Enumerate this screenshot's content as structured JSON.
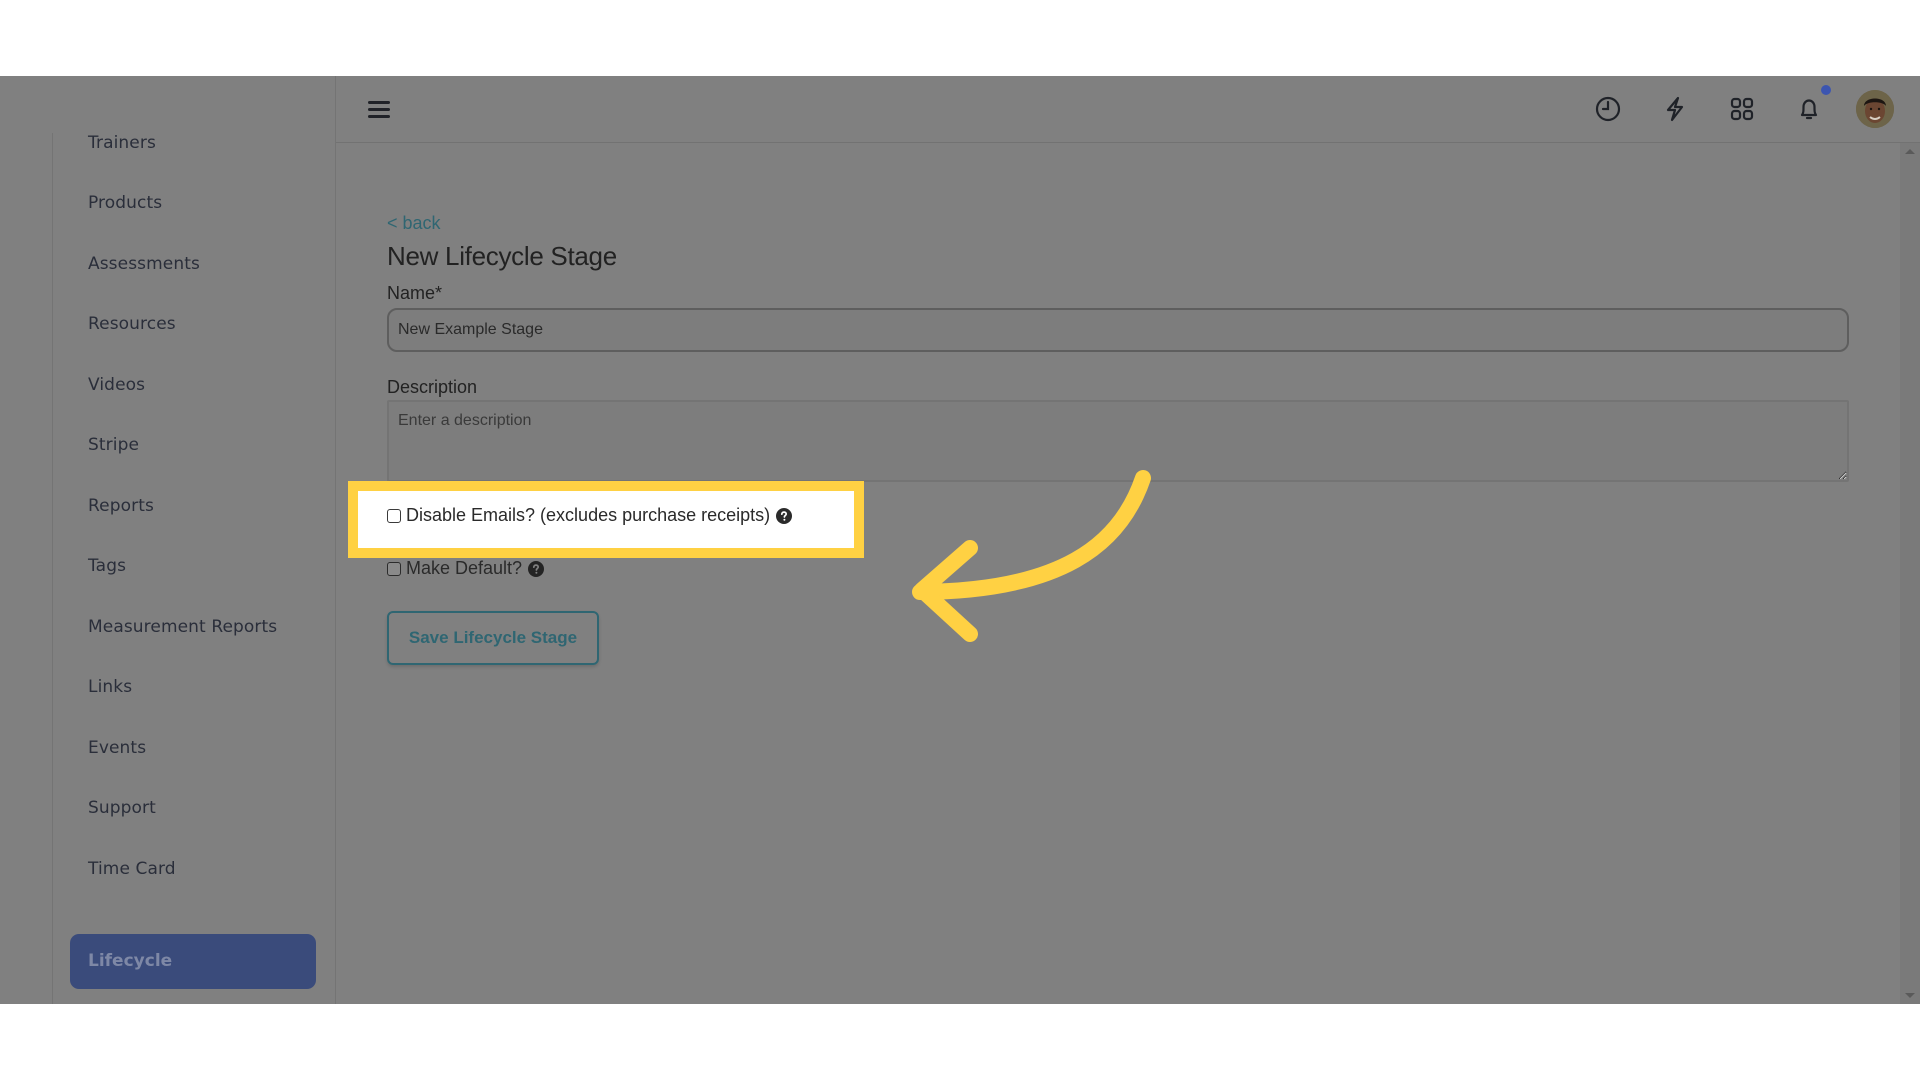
{
  "sidebar": {
    "items": [
      {
        "label": "Trainers"
      },
      {
        "label": "Products"
      },
      {
        "label": "Assessments"
      },
      {
        "label": "Resources"
      },
      {
        "label": "Videos"
      },
      {
        "label": "Stripe"
      },
      {
        "label": "Reports"
      },
      {
        "label": "Tags"
      },
      {
        "label": "Measurement Reports"
      },
      {
        "label": "Links"
      },
      {
        "label": "Events"
      },
      {
        "label": "Support"
      },
      {
        "label": "Time Card"
      }
    ],
    "active_item": {
      "label": "Lifecycle"
    }
  },
  "header": {
    "icons": [
      "menu-icon",
      "clock-icon",
      "lightning-icon",
      "apps-grid-icon",
      "bell-icon",
      "user-avatar"
    ],
    "notification_dot_color": "#3c55b0"
  },
  "form": {
    "back_label": "< back",
    "title": "New Lifecycle Stage",
    "name_label": "Name*",
    "name_value": "New Example Stage",
    "description_label": "Description",
    "description_placeholder": "Enter a description",
    "disable_emails_label": "Disable Emails? (excludes purchase receipts)",
    "disable_emails_checked": false,
    "make_default_label": "Make Default?",
    "make_default_checked": false,
    "save_label": "Save Lifecycle Stage"
  },
  "annotation": {
    "highlight_color": "#ffd143",
    "target": "Disable Emails? (excludes purchase receipts)"
  },
  "colors": {
    "accent": "#2f6672",
    "active_nav": "#3a4b7b"
  }
}
